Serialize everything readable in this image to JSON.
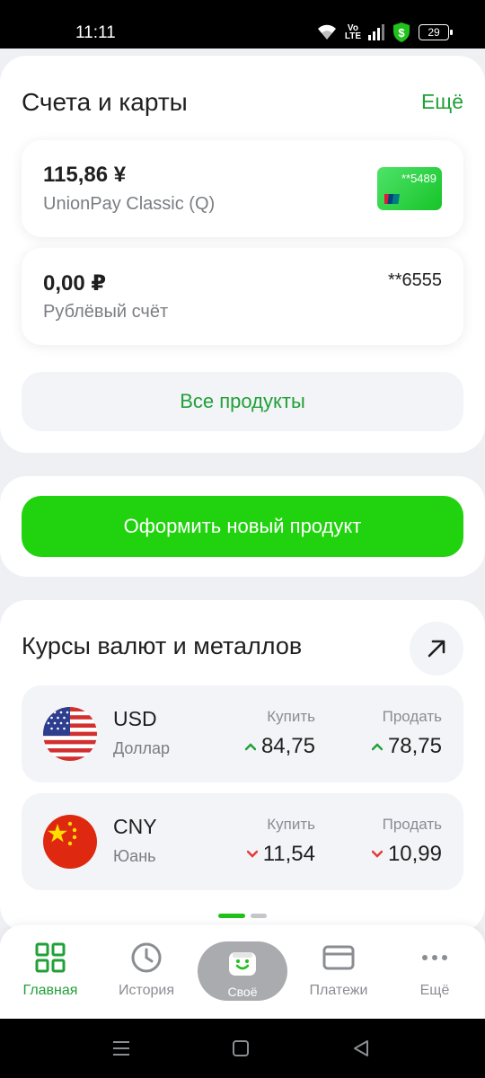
{
  "status_bar": {
    "time": "11:11",
    "volte": "Vo LTE",
    "battery": "29",
    "icons": [
      "wifi-icon",
      "volte-icon",
      "signal-icon",
      "shield-dollar-icon",
      "battery-icon"
    ]
  },
  "accounts": {
    "title": "Счета и карты",
    "more": "Ещё",
    "items": [
      {
        "amount": "115,86 ¥",
        "name": "UnionPay Classic (Q)",
        "card_mask": "**5489",
        "card_logo": "unionpay-logo"
      },
      {
        "amount": "0,00 ₽",
        "name": "Рублёвый счёт",
        "mask": "**6555"
      }
    ],
    "all_products": "Все продукты"
  },
  "new_product": {
    "label": "Оформить новый продукт"
  },
  "rates": {
    "title": "Курсы валют и металлов",
    "arrow_icon": "arrow-up-right-icon",
    "rows": [
      {
        "code": "USD",
        "name": "Доллар",
        "buy_label": "Купить",
        "buy": "84,75",
        "buy_trend": "up",
        "sell_label": "Продать",
        "sell": "78,75",
        "sell_trend": "up",
        "flag": "us-flag-icon"
      },
      {
        "code": "CNY",
        "name": "Юань",
        "buy_label": "Купить",
        "buy": "11,54",
        "buy_trend": "down",
        "sell_label": "Продать",
        "sell": "10,99",
        "sell_trend": "down",
        "flag": "cn-flag-icon"
      }
    ],
    "pager": {
      "pages": 2,
      "active": 1
    }
  },
  "tabbar": {
    "items": [
      {
        "label": "Главная",
        "icon": "grid-icon",
        "active": true
      },
      {
        "label": "История",
        "icon": "clock-icon",
        "active": false
      },
      {
        "label": "Своё",
        "icon": "smile-bag-icon",
        "active": false
      },
      {
        "label": "Платежи",
        "icon": "card-icon",
        "active": false
      },
      {
        "label": "Ещё",
        "icon": "dots-icon",
        "active": false
      }
    ]
  },
  "colors": {
    "brand_green": "#21a038",
    "button_green": "#21d20e",
    "trend_up": "#21a038",
    "trend_down": "#e53935"
  }
}
